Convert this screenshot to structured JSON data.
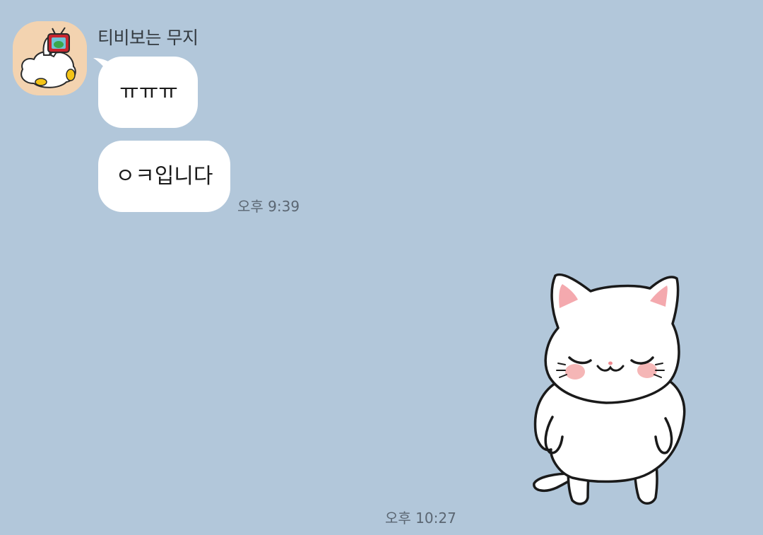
{
  "chat": {
    "sender": {
      "name": "티비보는 무지",
      "avatar_icon": "muzi-watching-tv-avatar"
    },
    "messages": [
      {
        "text": "ㅠㅠㅠ"
      },
      {
        "text": "ㅇㅋ입니다",
        "time": "오후 9:39"
      }
    ],
    "sent_sticker": {
      "icon": "white-cat-sticker",
      "time": "오후 10:27"
    }
  },
  "colors": {
    "background": "#b2c7da",
    "bubble": "#ffffff",
    "avatar_bg": "#f3d3b0"
  }
}
